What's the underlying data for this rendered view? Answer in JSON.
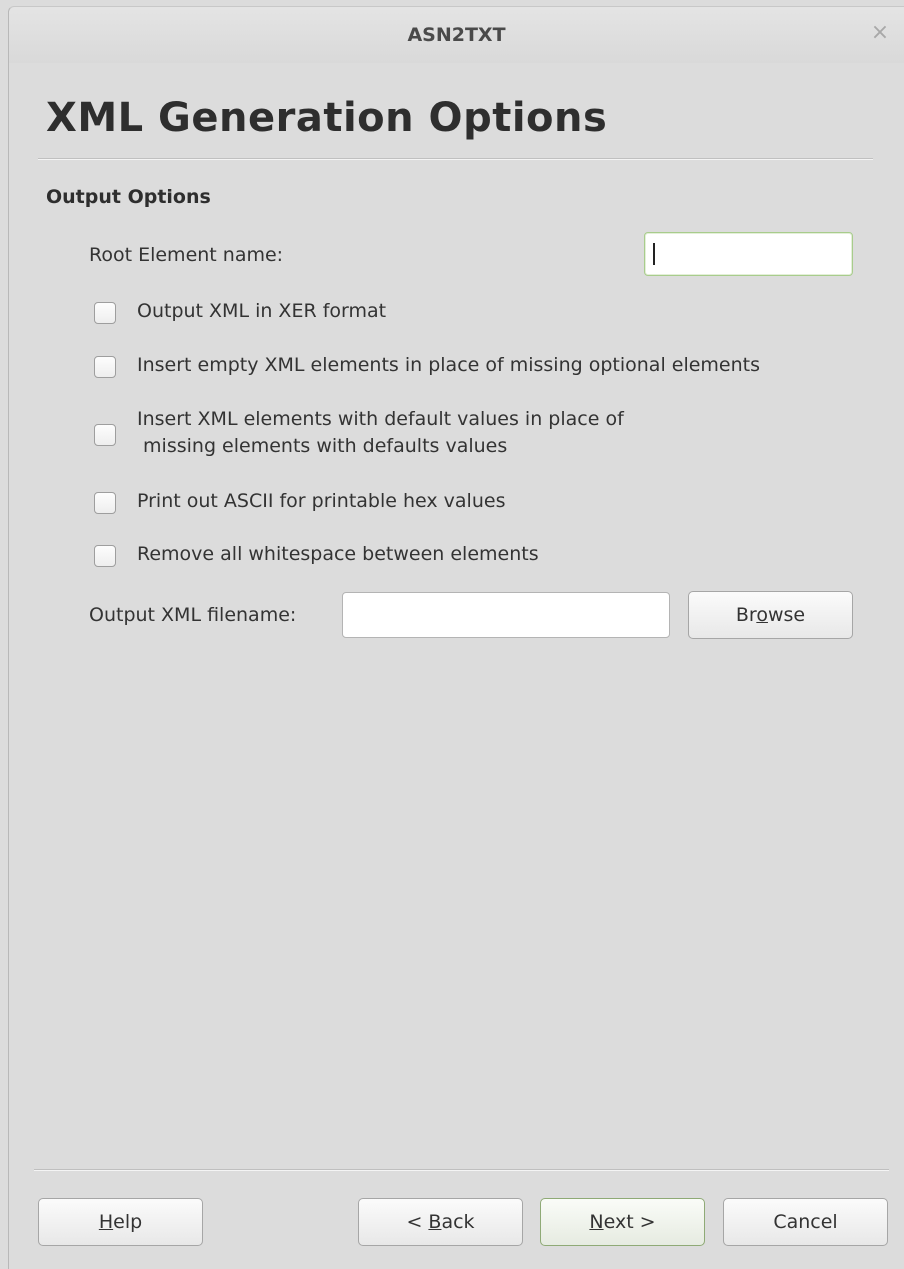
{
  "window": {
    "title": "ASN2TXT",
    "close_glyph": "×"
  },
  "page": {
    "heading": "XML Generation Options"
  },
  "output_options": {
    "section_title": "Output Options",
    "root_element_label": "Root Element name:",
    "root_element_value": "",
    "checkboxes": [
      {
        "label": "Output XML in XER format",
        "checked": false
      },
      {
        "label": "Insert empty XML elements in place of missing optional elements",
        "checked": false
      },
      {
        "label_line1": "Insert XML elements with default values in place of",
        "label_line2": " missing elements with defaults values",
        "checked": false
      },
      {
        "label": "Print out ASCII for printable hex values",
        "checked": false
      },
      {
        "label": "Remove all whitespace between elements",
        "checked": false
      }
    ],
    "filename_label": "Output XML filename:",
    "filename_value": "",
    "browse_button": {
      "pre": "Br",
      "mnemonic": "o",
      "post": "wse"
    }
  },
  "footer": {
    "help_button": {
      "pre": "",
      "mnemonic": "H",
      "post": "elp"
    },
    "back_button": {
      "pre": "< ",
      "mnemonic": "B",
      "post": "ack"
    },
    "next_button": {
      "pre": "",
      "mnemonic": "N",
      "post": "ext >"
    },
    "cancel_button": "Cancel"
  }
}
